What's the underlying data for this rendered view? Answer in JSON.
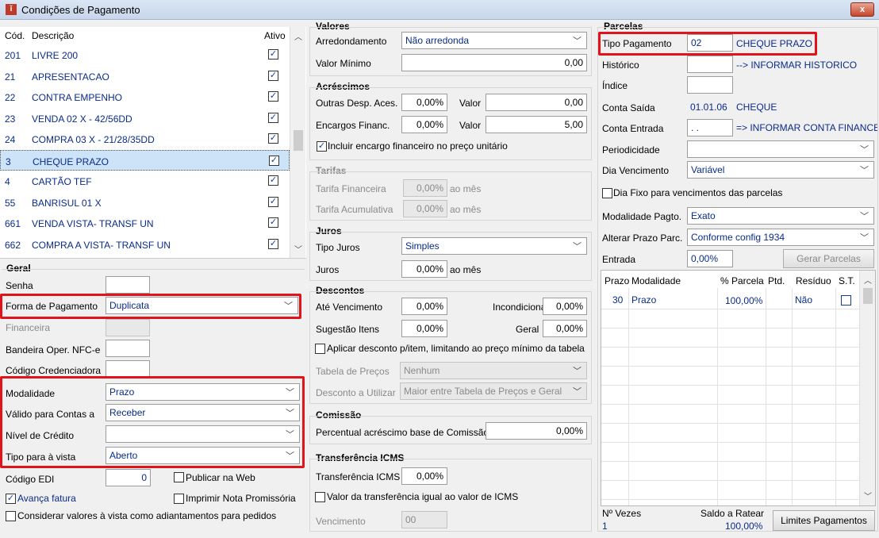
{
  "window": {
    "title": "Condições de Pagamento",
    "close": "x"
  },
  "list": {
    "headers": {
      "code": "Cód.",
      "desc": "Descrição",
      "active": "Ativo"
    },
    "rows": [
      {
        "code": "201",
        "desc": "LIVRE 200",
        "active": true
      },
      {
        "code": "21",
        "desc": "APRESENTACAO",
        "active": true
      },
      {
        "code": "22",
        "desc": "CONTRA EMPENHO",
        "active": true
      },
      {
        "code": "23",
        "desc": "VENDA 02 X - 42/56DD",
        "active": true
      },
      {
        "code": "24",
        "desc": "COMPRA 03 X - 21/28/35DD",
        "active": true
      },
      {
        "code": "3",
        "desc": "CHEQUE PRAZO",
        "active": true
      },
      {
        "code": "4",
        "desc": "CARTÃO TEF",
        "active": true
      },
      {
        "code": "55",
        "desc": "BANRISUL 01 X",
        "active": true
      },
      {
        "code": "661",
        "desc": "VENDA VISTA- TRANSF UN",
        "active": true
      },
      {
        "code": "662",
        "desc": "COMPRA A VISTA- TRANSF UN",
        "active": true
      }
    ]
  },
  "geral": {
    "title": "Geral",
    "senha_label": "Senha",
    "forma_label": "Forma de Pagamento",
    "forma_value": "Duplicata",
    "financeira_label": "Financeira",
    "bandeira_label": "Bandeira Oper. NFC-e",
    "credenciadora_label": "Código Credenciadora",
    "modalidade_label": "Modalidade",
    "modalidade_value": "Prazo",
    "valido_label": "Válido para Contas a",
    "valido_value": "Receber",
    "nivel_label": "Nível de Crédito",
    "nivel_value": "",
    "tipo_vista_label": "Tipo para à vista",
    "tipo_vista_value": "Aberto",
    "edi_label": "Código EDI",
    "edi_value": "0",
    "publicar_label": "Publicar na Web",
    "avanca_label": "Avança fatura",
    "imprimir_label": "Imprimir Nota Promissória",
    "considerar_label": "Considerar valores à vista como adiantamentos para pedidos"
  },
  "valores": {
    "title": "Valores",
    "arred_label": "Arredondamento",
    "arred_value": "Não arredonda",
    "minimo_label": "Valor Mínimo",
    "minimo_value": "0,00"
  },
  "acrescimos": {
    "title": "Acréscimos",
    "outras_label": "Outras Desp. Aces.",
    "outras_pct": "0,00%",
    "valor_label": "Valor",
    "outras_valor": "0,00",
    "encargos_label": "Encargos Financ.",
    "encargos_pct": "0,00%",
    "encargos_valor": "5,00",
    "incluir_label": "Incluir encargo financeiro no preço unitário"
  },
  "tarifas": {
    "title": "Tarifas",
    "fin_label": "Tarifa Financeira",
    "fin_value": "0,00%",
    "acum_label": "Tarifa Acumulativa",
    "acum_value": "0,00%",
    "ao_mes": "ao mês"
  },
  "juros": {
    "title": "Juros",
    "tipo_label": "Tipo Juros",
    "tipo_value": "Simples",
    "juros_label": "Juros",
    "juros_value": "0,00%",
    "ao_mes": "ao mês"
  },
  "descontos": {
    "title": "Descontos",
    "ate_label": "Até Vencimento",
    "ate_value": "0,00%",
    "incond_label": "Incondicional",
    "incond_value": "0,00%",
    "sug_label": "Sugestão Itens",
    "sug_value": "0,00%",
    "geral_label": "Geral",
    "geral_value": "0,00%",
    "aplicar_label": "Aplicar desconto p/item, limitando ao preço mínimo da tabela",
    "tabela_label": "Tabela de Preços",
    "tabela_value": "Nenhum",
    "utilizar_label": "Desconto a Utilizar",
    "utilizar_value": "Maior entre Tabela de Preços e Geral"
  },
  "comissao": {
    "title": "Comissão",
    "perc_label": "Percentual acréscimo base de Comissão",
    "perc_value": "0,00%"
  },
  "icms": {
    "title": "Transferência ICMS",
    "transf_label": "Transferência ICMS",
    "transf_value": "0,00%",
    "igual_label": "Valor da transferência igual ao valor de ICMS",
    "venc_label": "Vencimento",
    "venc_value": "00"
  },
  "parcelas": {
    "title": "Parcelas",
    "tipo_label": "Tipo Pagamento",
    "tipo_code": "02",
    "tipo_desc": "CHEQUE PRAZO",
    "hist_label": "Histórico",
    "hist_hint": "--> INFORMAR HISTORICO",
    "indice_label": "Índice",
    "saida_label": "Conta Saída",
    "saida_code": "01.01.06",
    "saida_desc": "CHEQUE",
    "entrada_label": "Conta Entrada",
    "entrada_code": ". .",
    "entrada_hint": "=> INFORMAR CONTA FINANCEI",
    "period_label": "Periodicidade",
    "period_value": "",
    "diav_label": "Dia Vencimento",
    "diav_value": "Variável",
    "diafixo_label": "Dia Fixo para vencimentos das parcelas",
    "modal_label": "Modalidade Pagto.",
    "modal_value": "Exato",
    "alterar_label": "Alterar Prazo Parc.",
    "alterar_value": "Conforme config 1934",
    "entrada2_label": "Entrada",
    "entrada2_value": "0,00%",
    "gerar_btn": "Gerar Parcelas",
    "grid_headers": {
      "prazo": "Prazo",
      "modalidade": "Modalidade",
      "parcela": "% Parcela",
      "ptd": "Ptd.",
      "residuo": "Resíduo",
      "st": "S.T."
    },
    "grid_rows": [
      {
        "prazo": "30",
        "modalidade": "Prazo",
        "parcela": "100,00%",
        "ptd": "",
        "residuo": "Não"
      }
    ],
    "nvezes_label": "Nº Vezes",
    "nvezes_value": "1",
    "saldo_label": "Saldo a Ratear",
    "saldo_value": "100,00%",
    "limites_btn": "Limites Pagamentos"
  }
}
